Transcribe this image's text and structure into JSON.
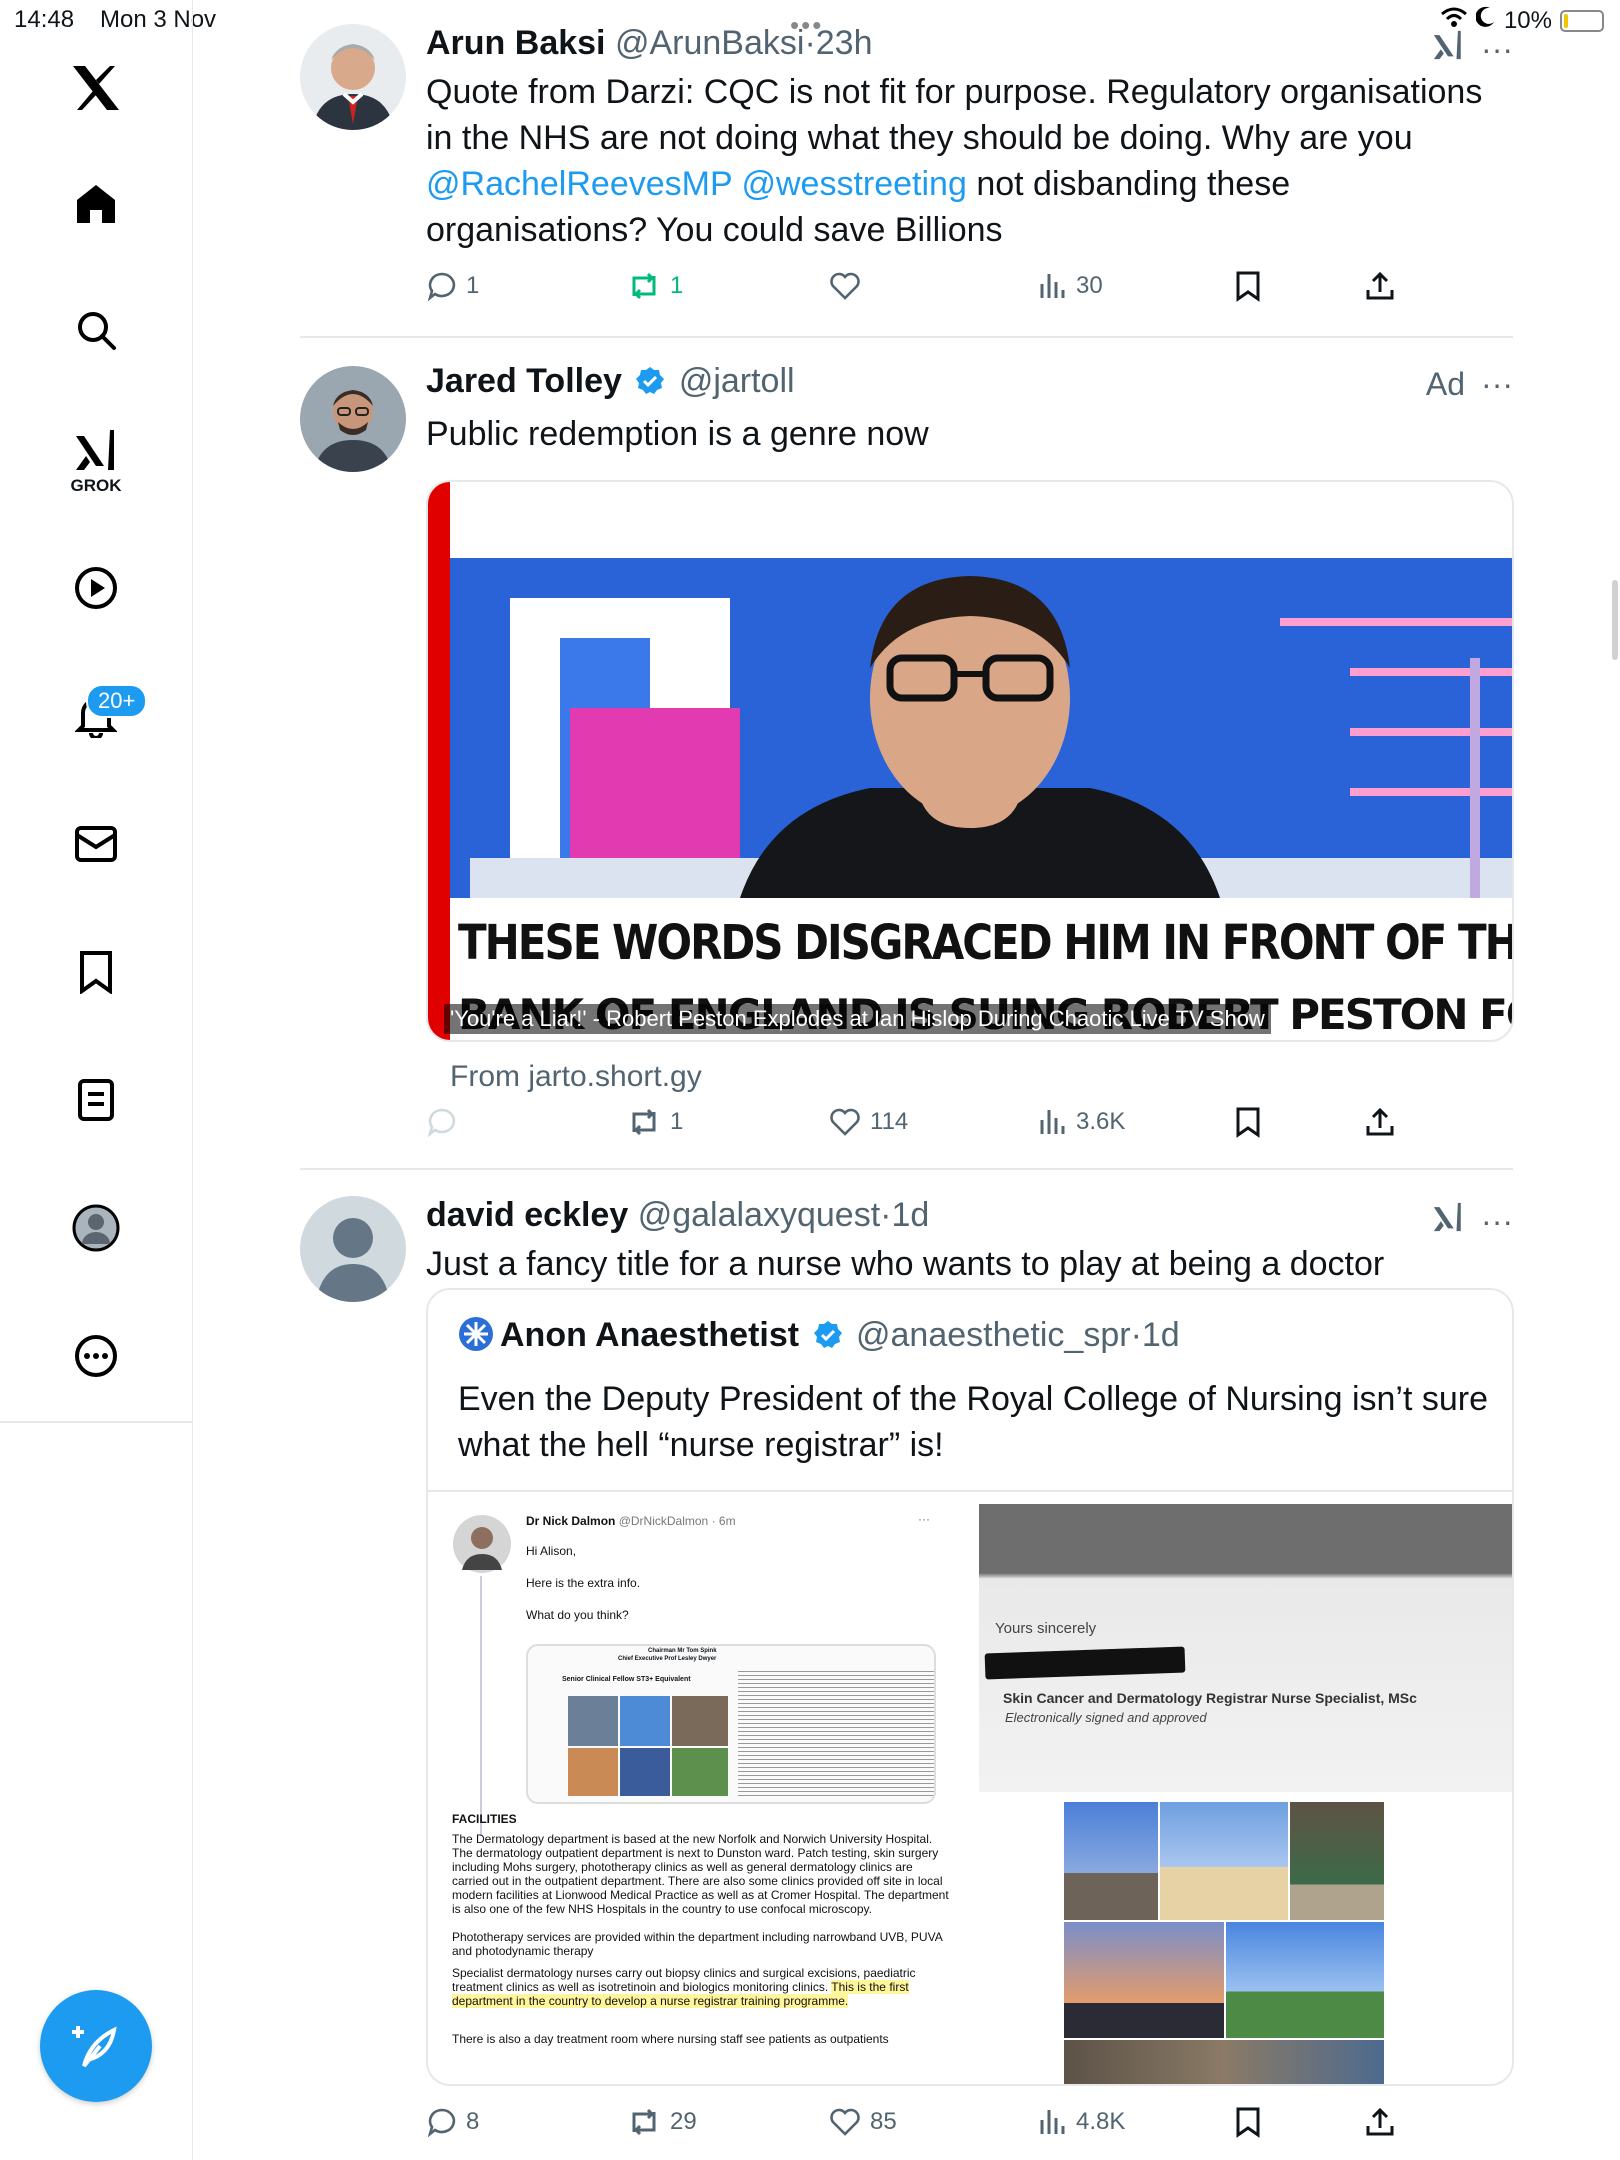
{
  "status_bar": {
    "time": "14:48",
    "date": "Mon 3 Nov",
    "battery": "10%",
    "battery_level": 0.1
  },
  "sidebar": {
    "grok_label": "GROK",
    "notifications_badge": "20+",
    "items": [
      "x-logo",
      "home",
      "search",
      "grok",
      "video",
      "notifications",
      "messages",
      "bookmarks",
      "lists",
      "profile",
      "more"
    ]
  },
  "tweets": [
    {
      "name": "Arun Baksi",
      "handle": "@ArunBaksi",
      "sep": "·",
      "time": "23h",
      "text_parts": {
        "p1": "Quote from Darzi: CQC is not fit for purpose. Regulatory organisations in the NHS are not doing what they should be doing. Why are you ",
        "m1": "@RachelReevesMP",
        "sp": " ",
        "m2": "@wesstreeting",
        "p2": " not disbanding these organisations? You could save Billions"
      },
      "replies": "1",
      "reposts": "1",
      "likes": "",
      "views": "30"
    },
    {
      "name": "Jared Tolley",
      "handle": "@jartoll",
      "ad_label": "Ad",
      "text": "Public redemption is a genre now",
      "card": {
        "headline1": "THESE WORDS DISGRACED HIM IN FRONT OF THE WHOLE COUNTRY!",
        "headline2": "BANK OF ENGLAND IS SUING ROBERT PESTON FOR WHAT HE SAID",
        "overlay": "'You're a Liar!' - Robert Peston Explodes at Ian Hislop During Chaotic Live TV Show",
        "from": "From jarto.short.gy"
      },
      "replies": "",
      "reposts": "1",
      "likes": "114",
      "views": "3.6K"
    },
    {
      "name": "david eckley",
      "handle": "@galalaxyquest",
      "sep": "·",
      "time": "1d",
      "text": "Just a fancy title for a nurse who wants to play at being a doctor",
      "quote": {
        "name": "Anon Anaesthetist",
        "handle": "@anaesthetic_spr",
        "sep": "·",
        "time": "1d",
        "text": "Even the Deputy President of the Royal College of Nursing isn’t sure what the hell “nurse registrar” is!",
        "doc": {
          "author": "Dr Nick Dalmon",
          "author_handle": "@DrNickDalmon · 6m",
          "more": "···",
          "line1": "Hi Alison,",
          "line2": "Here is the extra info.",
          "line3": "What do you think?",
          "embed_header1": "Chairman Mr Tom Spink",
          "embed_header2": "Chief Executive Prof Lesley Dwyer",
          "embed_label": "Senior Clinical Fellow ST3+ Equivalent",
          "section": "FACILITIES",
          "para1": "The Dermatology department is based at the new Norfolk and Norwich University Hospital. The dermatology outpatient department is next to Dunston ward. Patch testing, skin surgery including Mohs surgery, phototherapy clinics as well as general dermatology clinics are carried out in the outpatient department. There are also some clinics provided off site in local modern facilities at Lionwood Medical Practice as well as at Cromer Hospital. The department is also one of the few NHS Hospitals in the country to use confocal microscopy.",
          "para2": "Phototherapy services are provided within the department including narrowband UVB, PUVA and photodynamic therapy",
          "para3a": "Specialist dermatology nurses carry out biopsy clinics and surgical excisions, paediatric treatment clinics as well as isotretinoin and biologics monitoring clinics.",
          "para3b": "This is the first department in the country to develop a nurse registrar training programme.",
          "para4": "There is also a day treatment room where nursing staff see patients as outpatients"
        },
        "letter": {
          "closing": "Yours sincerely",
          "title": "Skin Cancer and Dermatology Registrar Nurse Specialist, MSc",
          "signed": "Electronically signed and approved"
        }
      },
      "replies": "8",
      "reposts": "29",
      "likes": "85",
      "views": "4.8K"
    }
  ],
  "colors": {
    "accent": "#1d9bf0",
    "repost_active": "#00ba7c",
    "ad_red": "#e00000",
    "muted": "#536471"
  }
}
